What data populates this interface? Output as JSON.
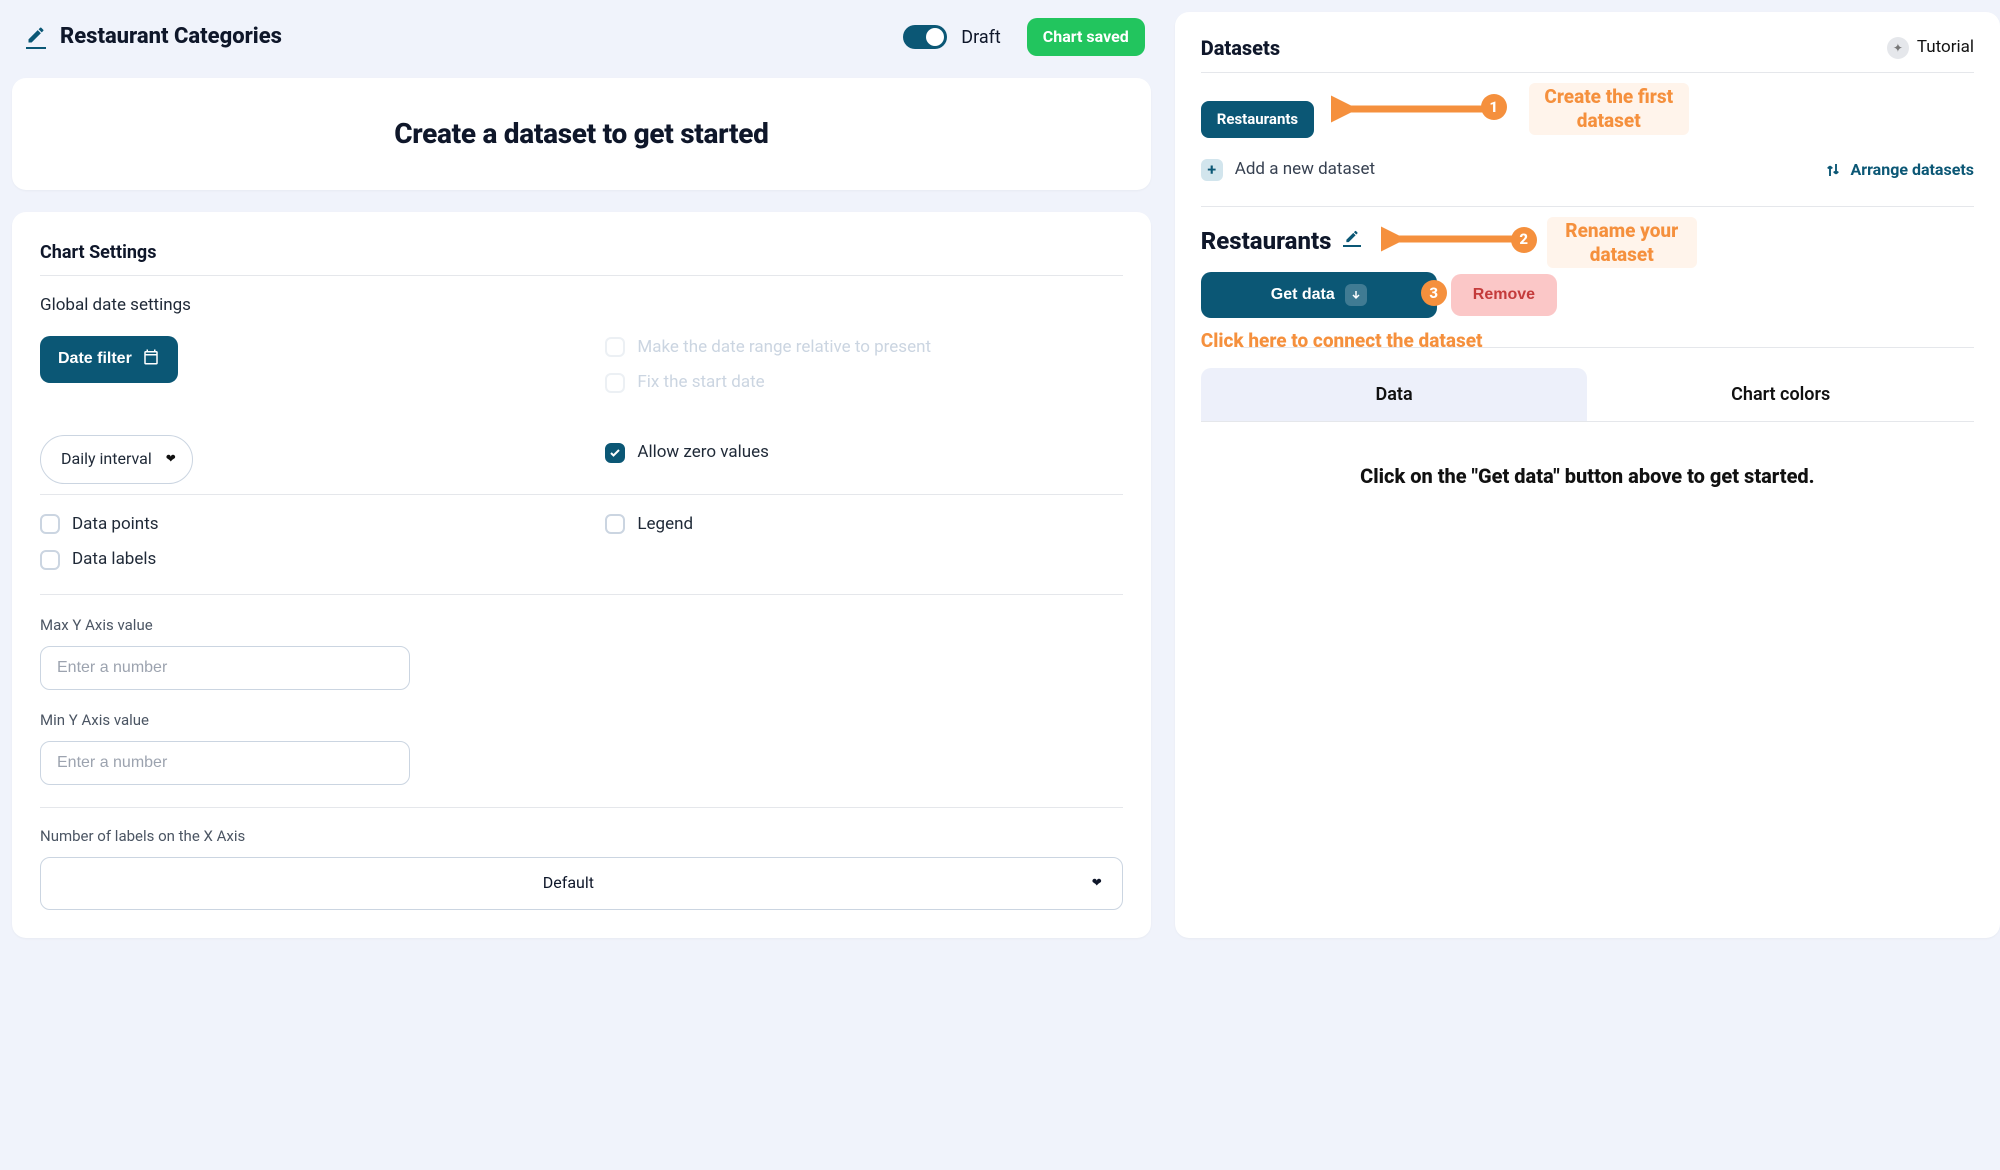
{
  "header": {
    "title": "Restaurant Categories",
    "draft_label": "Draft",
    "draft_on": true,
    "saved_label": "Chart saved"
  },
  "empty_card": {
    "heading": "Create a dataset to get started"
  },
  "settings": {
    "section_title": "Chart Settings",
    "global_date_label": "Global date settings",
    "date_filter_button": "Date filter",
    "relative_label": "Make the date range relative to present",
    "fix_start_label": "Fix the start date",
    "interval_select": "Daily interval",
    "allow_zero_label": "Allow zero values",
    "allow_zero_checked": true,
    "data_points_label": "Data points",
    "data_labels_label": "Data labels",
    "legend_label": "Legend",
    "max_y_label": "Max Y Axis value",
    "min_y_label": "Min Y Axis value",
    "number_placeholder": "Enter a number",
    "xaxis_count_label": "Number of labels on the X Axis",
    "xaxis_count_select": "Default"
  },
  "datasets": {
    "panel_title": "Datasets",
    "tutorial_badge": "Tutorial",
    "chip_label": "Restaurants",
    "hint1": "Create the first dataset",
    "add_new_label": "Add a new dataset",
    "arrange_label": "Arrange datasets",
    "name": "Restaurants",
    "hint2": "Rename your dataset",
    "get_data_button": "Get data",
    "remove_button": "Remove",
    "hint3": "Click here to connect the dataset",
    "tabs": {
      "data": "Data",
      "colors": "Chart colors"
    },
    "placeholder_msg": "Click on the \"Get data\" button above to get started.",
    "badge1": "1",
    "badge2": "2",
    "badge3": "3"
  }
}
